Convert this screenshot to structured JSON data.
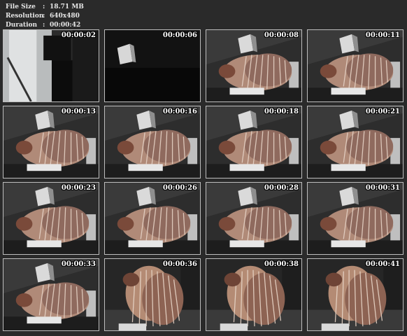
{
  "info": {
    "rows": [
      {
        "key": "File Size",
        "value": "18.71 MB"
      },
      {
        "key": "Resolution",
        "value": "640x480"
      },
      {
        "key": "Duration",
        "value": "00:00:42"
      }
    ]
  },
  "thumbnails": [
    {
      "time": "00:00:02",
      "scene": "door"
    },
    {
      "time": "00:00:06",
      "scene": "dark"
    },
    {
      "time": "00:00:08",
      "scene": "person"
    },
    {
      "time": "00:00:11",
      "scene": "person"
    },
    {
      "time": "00:00:13",
      "scene": "person"
    },
    {
      "time": "00:00:16",
      "scene": "person"
    },
    {
      "time": "00:00:18",
      "scene": "person"
    },
    {
      "time": "00:00:21",
      "scene": "person"
    },
    {
      "time": "00:00:23",
      "scene": "person"
    },
    {
      "time": "00:00:26",
      "scene": "person"
    },
    {
      "time": "00:00:28",
      "scene": "person"
    },
    {
      "time": "00:00:31",
      "scene": "person"
    },
    {
      "time": "00:00:33",
      "scene": "person"
    },
    {
      "time": "00:00:36",
      "scene": "standing"
    },
    {
      "time": "00:00:38",
      "scene": "standing"
    },
    {
      "time": "00:00:41",
      "scene": "standing"
    }
  ]
}
